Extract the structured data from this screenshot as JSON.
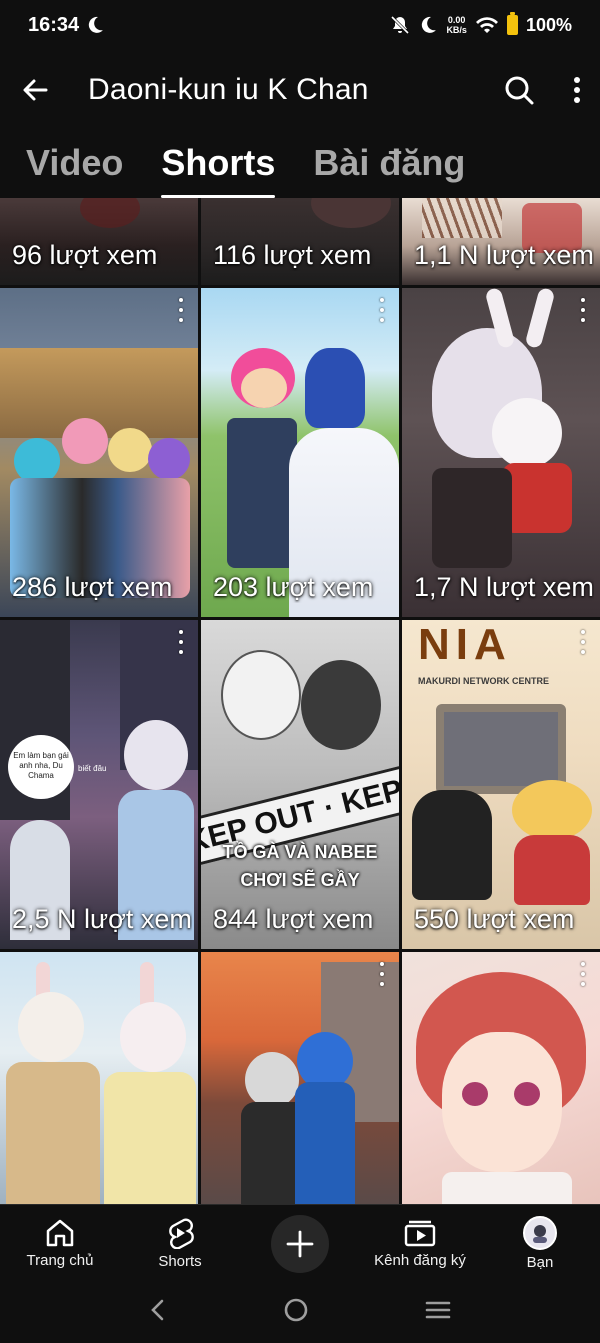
{
  "status_bar": {
    "time": "16:34",
    "net_speed_value": "0.00",
    "net_speed_unit": "KB/s",
    "battery": "100%"
  },
  "header": {
    "title": "Daoni-kun iu K Chan"
  },
  "tabs": [
    {
      "label": "Video",
      "active": false
    },
    {
      "label": "Shorts",
      "active": true
    },
    {
      "label": "Bài đăng",
      "active": false
    }
  ],
  "shorts": [
    {
      "views": "96 lượt xem"
    },
    {
      "views": "116 lượt xem"
    },
    {
      "views": "1,1 N lượt xem"
    },
    {
      "views": "286 lượt xem"
    },
    {
      "views": "203 lượt xem"
    },
    {
      "views": "1,7 N lượt xem"
    },
    {
      "views": "2,5 N lượt xem",
      "overlay_bubble": "Em làm bạn gái anh nha, Du Chama",
      "overlay_small": "biết đâu"
    },
    {
      "views": "844 lượt xem",
      "overlay_tape": "KEP OUT · KEP OUT",
      "overlay_caption_1": "TỒ GÀ VÀ NABEE",
      "overlay_caption_2": "CHƠI SẼ GẦY"
    },
    {
      "views": "550 lượt xem",
      "overlay_brand": "MAKURDI NETWORK CENTRE",
      "overlay_logo": "NIA"
    },
    {
      "views": ""
    },
    {
      "views": ""
    },
    {
      "views": ""
    }
  ],
  "bottom_nav": {
    "home": "Trang chủ",
    "shorts": "Shorts",
    "subscriptions": "Kênh đăng ký",
    "you": "Bạn"
  },
  "colors": {
    "background": "#0f0f0f",
    "battery": "#f4c20d",
    "tab_inactive": "#a8a8a8"
  }
}
